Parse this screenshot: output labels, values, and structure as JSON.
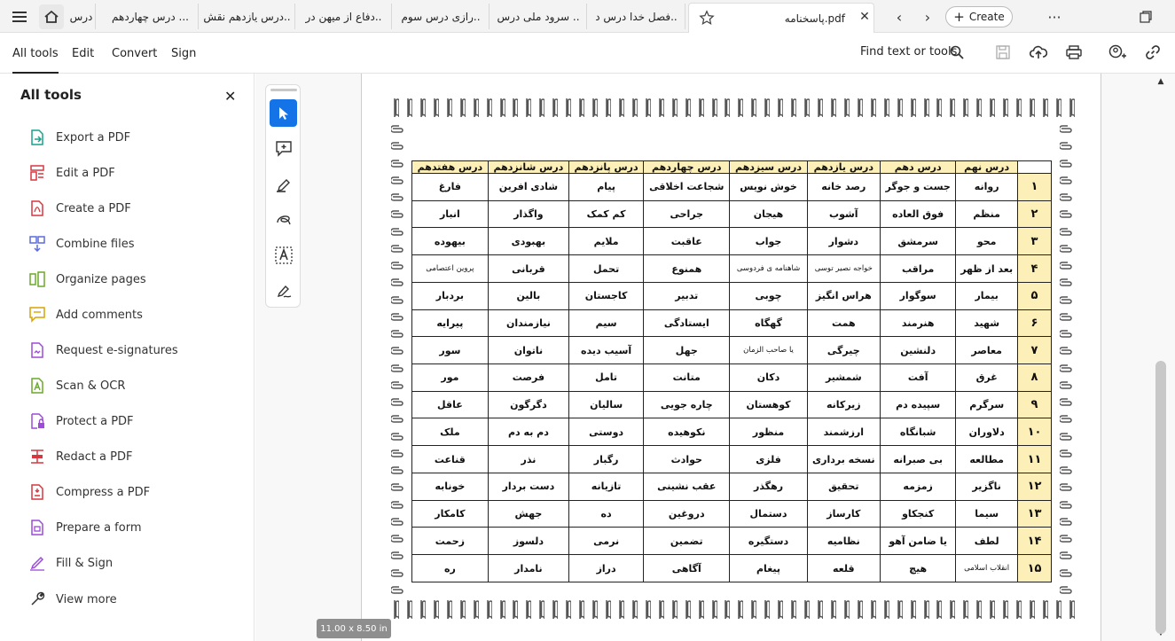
{
  "tabs": [
    "درس",
    "درس چهاردهم ...",
    "درس یازدهم نقش..",
    "دفاع از میهن در..",
    "رازی درس سوم..",
    "سرود ملی درس ..",
    "فصل خدا درس د..",
    "پاسخنامه.pdf"
  ],
  "create_label": "Create",
  "menu": {
    "all_tools": "All tools",
    "edit": "Edit",
    "convert": "Convert",
    "sign": "Sign",
    "find": "Find text or tools"
  },
  "sidebar": {
    "title": "All tools",
    "items": [
      "Export a PDF",
      "Edit a PDF",
      "Create a PDF",
      "Combine files",
      "Organize pages",
      "Add comments",
      "Request e-signatures",
      "Scan & OCR",
      "Protect a PDF",
      "Redact a PDF",
      "Compress a PDF",
      "Prepare a form",
      "Fill & Sign",
      "View more"
    ]
  },
  "page_size": "11.00 x 8.50 in",
  "colors": {
    "header_bg": "#fdefb8",
    "accent": "#1473e6",
    "icon_red": "#d7373f",
    "icon_purple": "#9c4cd6",
    "icon_teal": "#17a38c"
  },
  "table": {
    "headers": [
      "درس نهم",
      "درس دهم",
      "درس یازدهم",
      "درس سیزدهم",
      "درس چهاردهم",
      "درس پانزدهم",
      "درس شانزدهم",
      "درس هفتدهم"
    ],
    "rows": [
      {
        "n": "۱",
        "c": [
          "روانه",
          "جست و جوگر",
          "رصد خانه",
          "خوش نویس",
          "شجاعت اخلاقی",
          "پیام",
          "شادی افرین",
          "فارغ"
        ]
      },
      {
        "n": "۲",
        "c": [
          "منظم",
          "فوق العاده",
          "آشوب",
          "هیجان",
          "جراحی",
          "کم کمک",
          "واگذار",
          "انبار"
        ]
      },
      {
        "n": "۳",
        "c": [
          "محو",
          "سرمشق",
          "دشوار",
          "جواب",
          "عاقبت",
          "ملایم",
          "بهبودی",
          "بیهوده"
        ]
      },
      {
        "n": "۴",
        "c": [
          "بعد از ظهر",
          "مراقب",
          "خواجه نصیر توسی",
          "شاهنامه ی فردوسی",
          "همنوع",
          "تحمل",
          "قربانی",
          "پروین اعتصامی"
        ]
      },
      {
        "n": "۵",
        "c": [
          "بیمار",
          "سوگوار",
          "هراس انگیز",
          "چوبی",
          "تدبیر",
          "کاجستان",
          "بالین",
          "بردبار"
        ]
      },
      {
        "n": "۶",
        "c": [
          "شهید",
          "هنرمند",
          "همت",
          "گهگاه",
          "ایستادگی",
          "سیم",
          "نیازمندان",
          "پیرایه"
        ]
      },
      {
        "n": "۷",
        "c": [
          "معاصر",
          "دلنشین",
          "چیرگی",
          "یا صاحب الزمان",
          "جهل",
          "آسیب دیده",
          "ناتوان",
          "سور"
        ]
      },
      {
        "n": "۸",
        "c": [
          "غرق",
          "آفت",
          "شمشیر",
          "دکان",
          "متانت",
          "تامل",
          "فرصت",
          "مور"
        ]
      },
      {
        "n": "۹",
        "c": [
          "سرگرم",
          "سپیده دم",
          "زیرکانه",
          "کوهستان",
          "چاره جویی",
          "سالیان",
          "دگرگون",
          "عاقل"
        ]
      },
      {
        "n": "۱۰",
        "c": [
          "دلاوران",
          "شبانگاه",
          "ارزشمند",
          "منظور",
          "نکوهیده",
          "دوستی",
          "دم به دم",
          "ملک"
        ]
      },
      {
        "n": "۱۱",
        "c": [
          "مطالعه",
          "بی صبرانه",
          "نسخه برداری",
          "فلزی",
          "حوادث",
          "رگبار",
          "نذر",
          "قناعت"
        ]
      },
      {
        "n": "۱۲",
        "c": [
          "ناگزیر",
          "زمزمه",
          "تحقیق",
          "رهگذر",
          "عقب نشینی",
          "تازیانه",
          "دست بردار",
          "خونابه"
        ]
      },
      {
        "n": "۱۳",
        "c": [
          "سیما",
          "کنجکاو",
          "کارساز",
          "دستمال",
          "دروغین",
          "ده",
          "جهش",
          "کامکار"
        ]
      },
      {
        "n": "۱۴",
        "c": [
          "لطف",
          "یا ضامن آهو",
          "نظامیه",
          "دستگیره",
          "تضمین",
          "نرمی",
          "دلسوز",
          "زحمت"
        ]
      },
      {
        "n": "۱۵",
        "c": [
          "انقلاب اسلامی",
          "هیچ",
          "قلعه",
          "پیغام",
          "آگاهی",
          "دراز",
          "نامدار",
          "ره"
        ]
      }
    ]
  }
}
